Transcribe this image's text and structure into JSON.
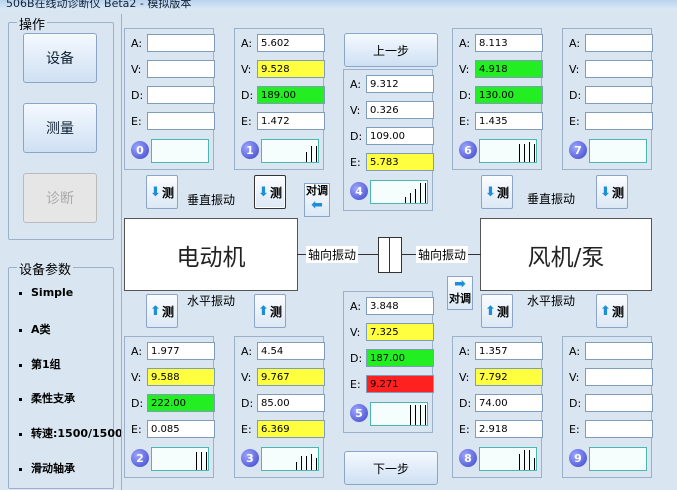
{
  "window": {
    "title": "506B在线动诊断仪 Beta2 - 模拟版本"
  },
  "operations": {
    "legend": "操作",
    "buttons": [
      {
        "label": "设备",
        "enabled": true
      },
      {
        "label": "测量",
        "enabled": true
      },
      {
        "label": "诊断",
        "enabled": false
      }
    ]
  },
  "device_params": {
    "legend": "设备参数",
    "items": [
      "Simple",
      "A类",
      "第1组",
      "柔性支承",
      "转速:1500/1500",
      "滑动轴承"
    ]
  },
  "panels": [
    {
      "id": "0",
      "A": "",
      "V": "",
      "D": "",
      "E": "",
      "V_color": "",
      "D_color": "",
      "E_color": "",
      "spectrum": []
    },
    {
      "id": "1",
      "A": "5.602",
      "V": "9.528",
      "D": "189.00",
      "E": "1.472",
      "V_color": "#ffff40",
      "D_color": "#22ee22",
      "E_color": "",
      "spectrum": [
        0.5,
        0.8,
        0.8
      ]
    },
    {
      "id": "6",
      "A": "8.113",
      "V": "4.918",
      "D": "130.00",
      "E": "1.435",
      "V_color": "#22ee22",
      "D_color": "#22ee22",
      "E_color": "",
      "spectrum": [
        0.9,
        0.9,
        1.0,
        0.9
      ]
    },
    {
      "id": "7",
      "A": "",
      "V": "",
      "D": "",
      "E": "",
      "V_color": "",
      "D_color": "",
      "E_color": "",
      "spectrum": []
    },
    {
      "id": "4",
      "A": "9.312",
      "V": "0.326",
      "D": "109.00",
      "E": "5.783",
      "V_color": "",
      "D_color": "",
      "E_color": "#ffff40",
      "spectrum": [
        0.3,
        0.5,
        0.7,
        1.0,
        1.0
      ]
    },
    {
      "id": "5",
      "A": "3.848",
      "V": "7.325",
      "D": "187.00",
      "E": "9.271",
      "V_color": "#ffff40",
      "D_color": "#22ee22",
      "E_color": "#ff2020",
      "spectrum": [
        1.0,
        1.0,
        1.0,
        1.0
      ]
    },
    {
      "id": "2",
      "A": "1.977",
      "V": "9.588",
      "D": "222.00",
      "E": "0.085",
      "V_color": "#ffff40",
      "D_color": "#22ee22",
      "E_color": "",
      "spectrum": [
        0.9,
        0.9,
        0.9
      ]
    },
    {
      "id": "3",
      "A": "4.54",
      "V": "9.767",
      "D": "85.00",
      "E": "6.369",
      "V_color": "#ffff40",
      "D_color": "",
      "E_color": "#ffff40",
      "spectrum": [
        0.4,
        0.7,
        0.7,
        0.8,
        0.6
      ]
    },
    {
      "id": "8",
      "A": "1.357",
      "V": "7.792",
      "D": "74.00",
      "E": "2.918",
      "V_color": "#ffff40",
      "D_color": "",
      "E_color": "",
      "spectrum": [
        0.8,
        1.0,
        1.0,
        0.6
      ]
    },
    {
      "id": "9",
      "A": "",
      "V": "",
      "D": "",
      "E": "",
      "V_color": "",
      "D_color": "",
      "E_color": "",
      "spectrum": []
    }
  ],
  "labels": {
    "field_A": "A:",
    "field_V": "V:",
    "field_D": "D:",
    "field_E": "E:",
    "vertical_vib": "垂直振动",
    "horizontal_vib": "水平振动",
    "axial_vib": "轴向振动",
    "motor": "电动机",
    "fan_pump": "风机/泵",
    "prev_step": "上一步",
    "next_step": "下一步",
    "measure": "测",
    "swap_top": "对调",
    "swap_bottom": "对调"
  },
  "colors": {
    "background": "#d9e6f2",
    "yellow": "#ffff40",
    "green": "#22ee22",
    "red": "#ff2020"
  }
}
